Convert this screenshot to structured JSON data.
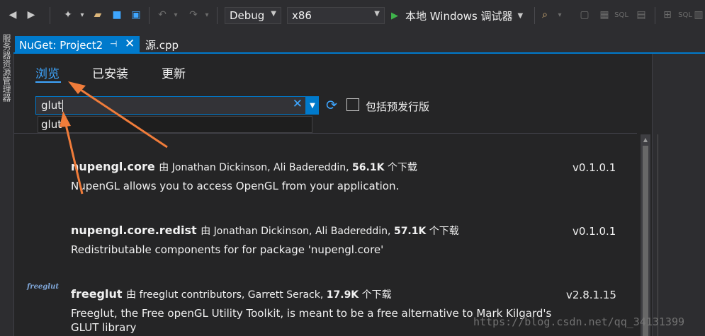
{
  "toolbar": {
    "configuration": "Debug",
    "platform": "x86",
    "run_label": "本地 Windows 调试器",
    "sql_label_1": "SQL",
    "sql_label_2": "SQL"
  },
  "left_strip": {
    "label": "服务器资源管理器"
  },
  "tabs": [
    {
      "label": "NuGet: Project2"
    },
    {
      "label": "源.cpp"
    }
  ],
  "nuget": {
    "nav": [
      "浏览",
      "已安装",
      "更新"
    ],
    "search": {
      "value": "glut",
      "suggestion": "glut"
    },
    "prerelease_label": "包括预发行版",
    "packages": [
      {
        "name": "nupengl.core",
        "by": "由",
        "authors": "Jonathan Dickinson,  Ali Badereddin,",
        "downloads": "56.1K",
        "downloads_suffix": "个下载",
        "description": "NupenGL allows you to access OpenGL from your application.",
        "version": "v0.1.0.1"
      },
      {
        "name": "nupengl.core.redist",
        "by": "由",
        "authors": "Jonathan Dickinson,  Ali Badereddin,",
        "downloads": "57.1K",
        "downloads_suffix": "个下载",
        "description": "Redistributable components for for package 'nupengl.core'",
        "version": "v0.1.0.1"
      },
      {
        "name": "freeglut",
        "by": "由",
        "authors": "freeglut contributors,  Garrett Serack,",
        "downloads": "17.9K",
        "downloads_suffix": "个下载",
        "description": "Freeglut, the Free openGL Utility Toolkit, is meant to be a free alternative to Mark Kilgard's GLUT library",
        "version": "v2.8.1.15",
        "logo_text": "freeglut"
      }
    ]
  },
  "watermark": "https://blog.csdn.net/qq_34131399",
  "colors": {
    "accent": "#007acc",
    "annotation": "#f07c3a"
  }
}
